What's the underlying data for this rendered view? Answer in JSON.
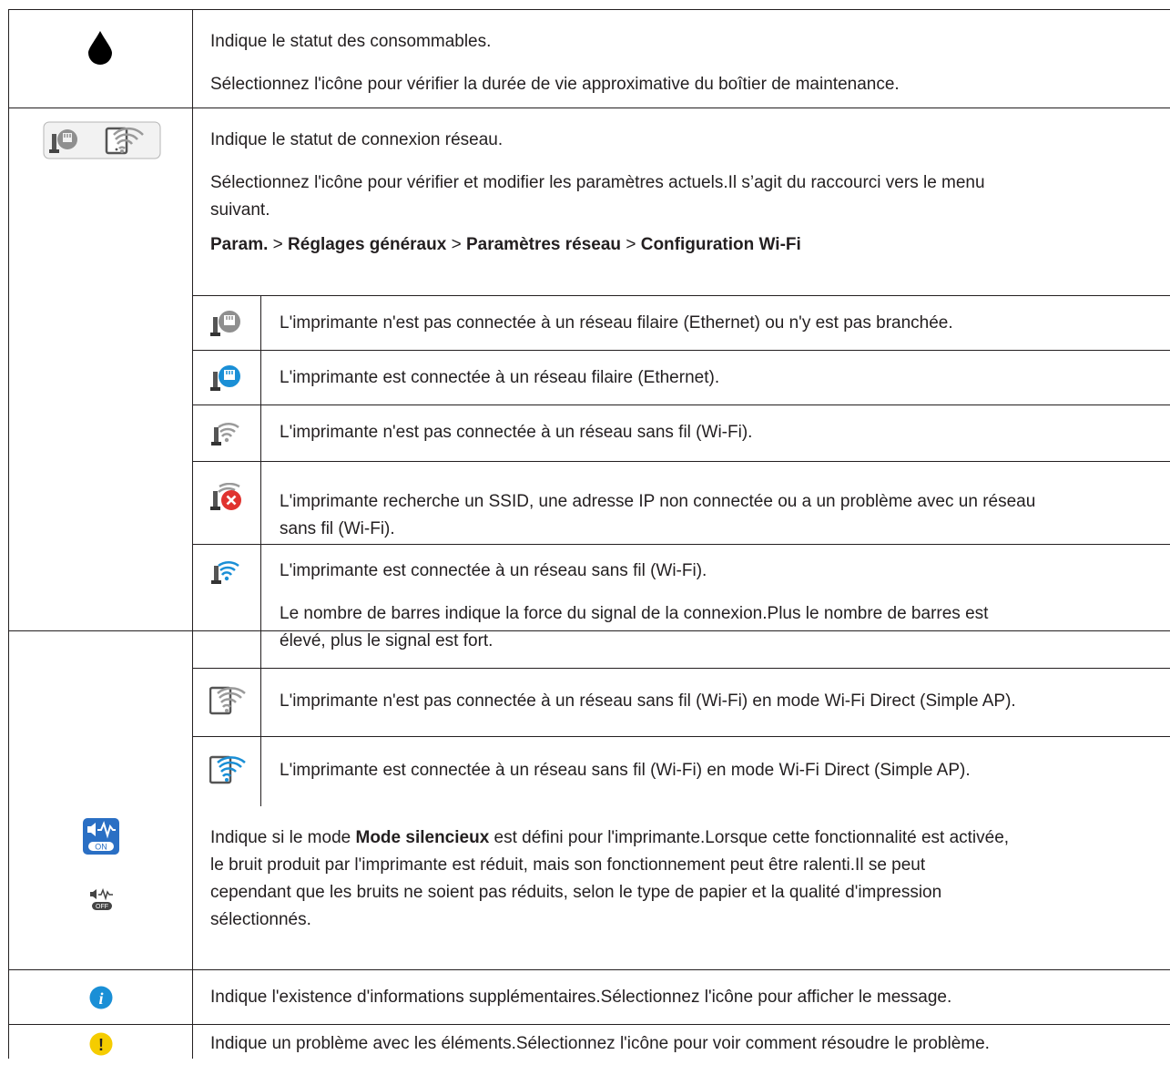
{
  "rows": {
    "ink": {
      "icon": "ink-drop-icon",
      "p1": "Indique le statut des consommables.",
      "p2": "Sélectionnez l'icône pour vérifier la durée de vie approximative du boîtier de maintenance."
    },
    "network": {
      "icon": "network-status-icons",
      "p1": "Indique le statut de connexion réseau.",
      "p2_line1": "Sélectionnez l'icône pour vérifier et modifier les paramètres actuels.Il s’agit du raccourci vers le menu",
      "p2_line2": "suivant.",
      "path": {
        "p1": "Param.",
        "sep": ">",
        "p2": "Réglages généraux",
        "p3": "Paramètres réseau",
        "p4": "Configuration Wi-Fi"
      },
      "sub": [
        {
          "icon": "ethernet-disconnected-icon",
          "line1": "L'imprimante n'est pas connectée à un réseau filaire (Ethernet) ou n'y est pas branchée."
        },
        {
          "icon": "ethernet-connected-icon",
          "line1": "L'imprimante est connectée à un réseau filaire (Ethernet)."
        },
        {
          "icon": "wifi-disconnected-icon",
          "line1": "L'imprimante n'est pas connectée à un réseau sans fil (Wi-Fi)."
        },
        {
          "icon": "wifi-error-icon",
          "line1": "L'imprimante recherche un SSID, une adresse IP non connectée ou a un problème avec un réseau",
          "line2": "sans fil (Wi-Fi)."
        },
        {
          "icon": "wifi-connected-icon",
          "line1": "L'imprimante est connectée à un réseau sans fil (Wi-Fi).",
          "p2_line1": "Le nombre de barres indique la force du signal de la connexion.Plus le nombre de barres est",
          "p2_line2": "élevé, plus le signal est fort."
        },
        {
          "icon": "wifi-direct-disconnected-icon",
          "line1": "L'imprimante n'est pas connectée à un réseau sans fil (Wi-Fi) en mode Wi-Fi Direct (Simple AP)."
        },
        {
          "icon": "wifi-direct-connected-icon",
          "line1": "L'imprimante est connectée à un réseau sans fil (Wi-Fi) en mode Wi-Fi Direct (Simple AP)."
        }
      ]
    },
    "quiet": {
      "icon_on": "quiet-mode-on-icon",
      "icon_off": "quiet-mode-off-icon",
      "on_label": "ON",
      "off_label": "OFF",
      "line1_a": "Indique si le mode ",
      "line1_bold": "Mode silencieux",
      "line1_b": " est défini pour l'imprimante.Lorsque cette fonctionnalité est activée,",
      "line2": "le bruit produit par l'imprimante est réduit, mais son fonctionnement peut être ralenti.Il se peut",
      "line3": "cependant que les bruits ne soient pas réduits, selon le type de papier et la qualité d'impression",
      "line4": "sélectionnés."
    },
    "info": {
      "icon": "info-icon",
      "glyph": "i",
      "text": "Indique l'existence d'informations supplémentaires.Sélectionnez l'icône pour afficher le message."
    },
    "warning": {
      "icon": "warning-icon",
      "glyph": "!",
      "text": "Indique un problème avec les éléments.Sélectionnez l'icône pour voir comment résoudre le problème."
    }
  },
  "colors": {
    "border": "#231f20",
    "blue": "#1a8fd6",
    "gray": "#8c8c8c",
    "red": "#e0332f",
    "yellow": "#f5cc00",
    "quiet_blue": "#2a6fc4"
  }
}
